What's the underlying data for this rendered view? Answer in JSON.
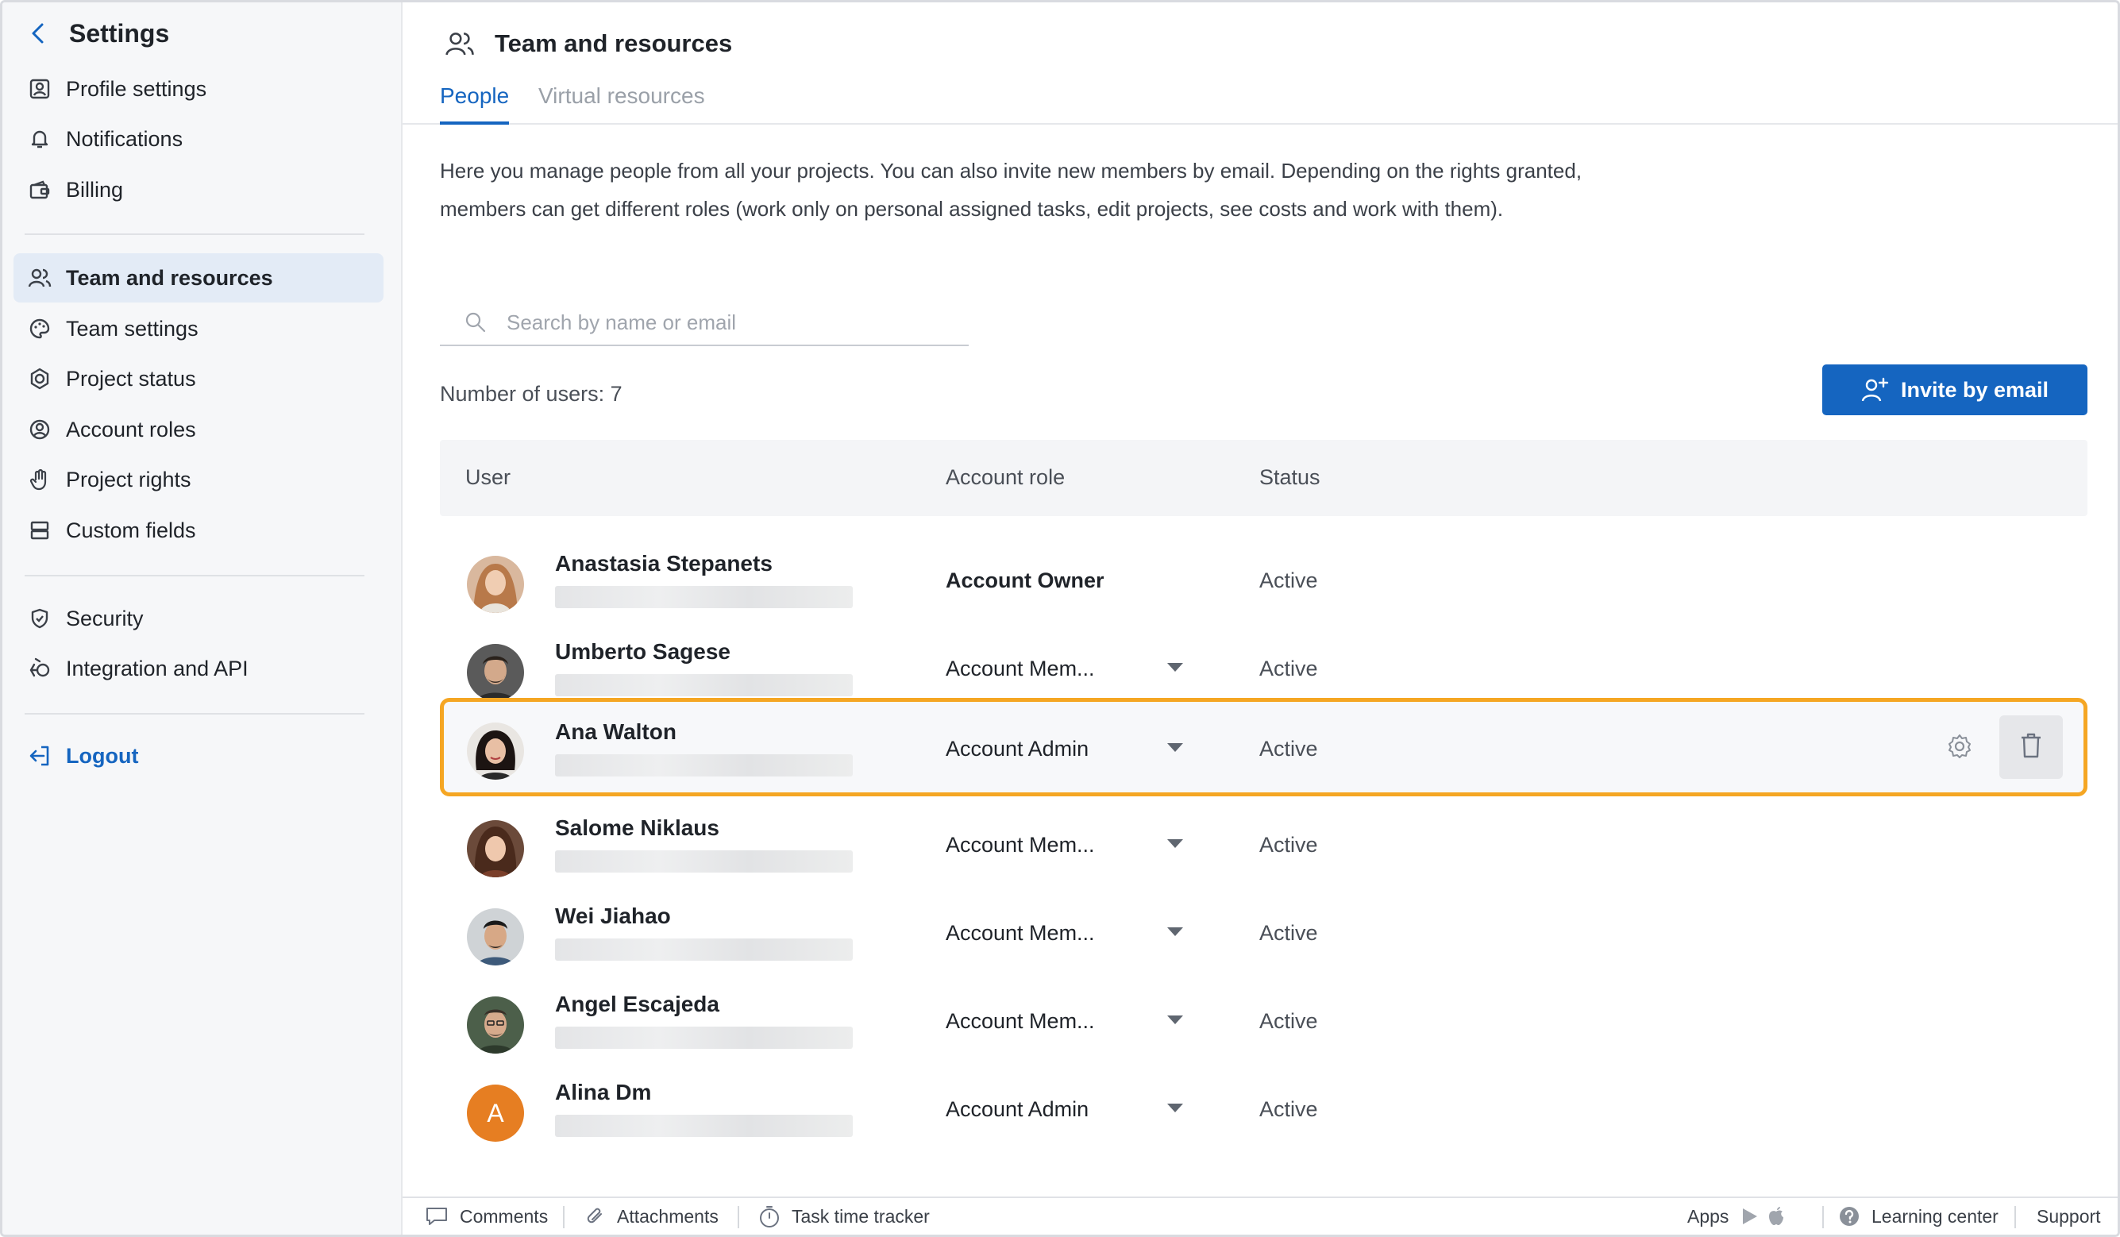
{
  "sidebar": {
    "title": "Settings",
    "items": [
      {
        "label": "Profile settings",
        "icon": "profile-icon"
      },
      {
        "label": "Notifications",
        "icon": "bell-icon"
      },
      {
        "label": "Billing",
        "icon": "wallet-icon"
      },
      {
        "label": "Team and resources",
        "icon": "team-icon",
        "active": true
      },
      {
        "label": "Team settings",
        "icon": "palette-icon"
      },
      {
        "label": "Project status",
        "icon": "status-icon"
      },
      {
        "label": "Account roles",
        "icon": "user-circle-icon"
      },
      {
        "label": "Project rights",
        "icon": "hand-icon"
      },
      {
        "label": "Custom fields",
        "icon": "fields-icon"
      },
      {
        "label": "Security",
        "icon": "shield-icon"
      },
      {
        "label": "Integration and API",
        "icon": "api-icon"
      }
    ],
    "logout": "Logout"
  },
  "header": {
    "title": "Team and resources",
    "tabs": [
      {
        "label": "People",
        "active": true
      },
      {
        "label": "Virtual resources",
        "active": false
      }
    ]
  },
  "description": "Here you manage people from all your projects. You can also invite new members by email. Depending on the rights granted, members can get different roles (work only on personal assigned tasks, edit projects, see costs and work with them).",
  "search": {
    "placeholder": "Search by name or email",
    "value": ""
  },
  "user_count_label": "Number of users: 7",
  "invite_button": "Invite by email",
  "table": {
    "columns": [
      "User",
      "Account role",
      "Status"
    ],
    "rows": [
      {
        "name": "Anastasia Stepanets",
        "role": "Account Owner",
        "status": "Active",
        "avatar": "photo"
      },
      {
        "name": "Umberto Sagese",
        "role": "Account Mem...",
        "status": "Active",
        "avatar": "photo"
      },
      {
        "name": "Ana Walton",
        "role": "Account Admin",
        "status": "Active",
        "avatar": "photo",
        "selected": true
      },
      {
        "name": "Salome Niklaus",
        "role": "Account Mem...",
        "status": "Active",
        "avatar": "photo"
      },
      {
        "name": "Wei Jiahao",
        "role": "Account Mem...",
        "status": "Active",
        "avatar": "photo"
      },
      {
        "name": "Angel Escajeda",
        "role": "Account Mem...",
        "status": "Active",
        "avatar": "photo"
      },
      {
        "name": "Alina Dm",
        "role": "Account Admin",
        "status": "Active",
        "avatar": "letter",
        "initial": "A"
      }
    ]
  },
  "footer": {
    "comments": "Comments",
    "attachments": "Attachments",
    "task_time_tracker": "Task time tracker",
    "apps": "Apps",
    "learning_center": "Learning center",
    "support": "Support"
  },
  "colors": {
    "accent": "#1565c0",
    "selection_outline": "#f5a623",
    "sidebar_bg": "#f6f7f9",
    "active_item_bg": "#e3ebf6",
    "letter_avatar": "#e67e22"
  }
}
